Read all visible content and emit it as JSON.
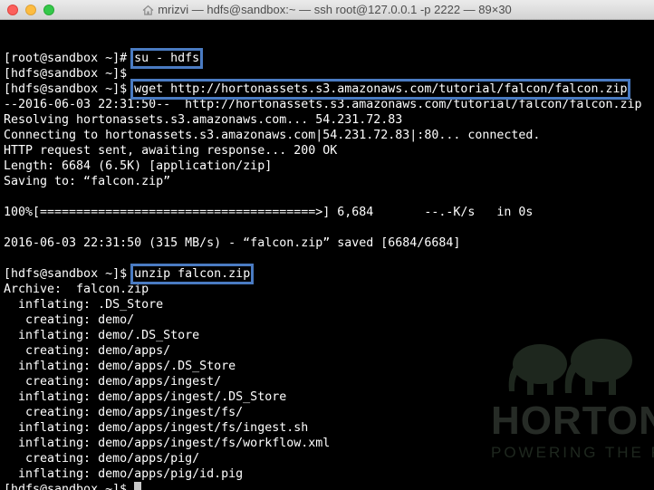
{
  "window": {
    "title": "mrizvi — hdfs@sandbox:~ — ssh root@127.0.0.1 -p 2222 — 89×30"
  },
  "icons": {
    "title_icon": "home-icon",
    "watermark": "hortonworks-elephant-logo"
  },
  "colors": {
    "background": "#000000",
    "text": "#ffffff",
    "highlight": "#4a7bc2"
  },
  "watermark": {
    "word": "HORTON",
    "tagline": "POWERING THE F"
  },
  "terminal": {
    "lines": [
      {
        "prompt": "",
        "command": ""
      },
      {
        "prompt": "[root@sandbox ~]# ",
        "command": "su - hdfs"
      },
      {
        "prompt": "[hdfs@sandbox ~]$",
        "command": ""
      },
      {
        "prompt": "[hdfs@sandbox ~]$ ",
        "command": "wget http://hortonassets.s3.amazonaws.com/tutorial/falcon/falcon.zip"
      },
      {
        "text": "--2016-06-03 22:31:50--  http://hortonassets.s3.amazonaws.com/tutorial/falcon/falcon.zip"
      },
      {
        "text": "Resolving hortonassets.s3.amazonaws.com... 54.231.72.83"
      },
      {
        "text": "Connecting to hortonassets.s3.amazonaws.com|54.231.72.83|:80... connected."
      },
      {
        "text": "HTTP request sent, awaiting response... 200 OK"
      },
      {
        "text": "Length: 6684 (6.5K) [application/zip]"
      },
      {
        "text": "Saving to: “falcon.zip”"
      },
      {
        "text": ""
      },
      {
        "text": "100%[======================================>] 6,684       --.-K/s   in 0s"
      },
      {
        "text": ""
      },
      {
        "text": "2016-06-03 22:31:50 (315 MB/s) - “falcon.zip” saved [6684/6684]"
      },
      {
        "text": ""
      },
      {
        "prompt": "[hdfs@sandbox ~]$ ",
        "command": "unzip falcon.zip"
      },
      {
        "text": "Archive:  falcon.zip"
      },
      {
        "text": "  inflating: .DS_Store"
      },
      {
        "text": "   creating: demo/"
      },
      {
        "text": "  inflating: demo/.DS_Store"
      },
      {
        "text": "   creating: demo/apps/"
      },
      {
        "text": "  inflating: demo/apps/.DS_Store"
      },
      {
        "text": "   creating: demo/apps/ingest/"
      },
      {
        "text": "  inflating: demo/apps/ingest/.DS_Store"
      },
      {
        "text": "   creating: demo/apps/ingest/fs/"
      },
      {
        "text": "  inflating: demo/apps/ingest/fs/ingest.sh"
      },
      {
        "text": "  inflating: demo/apps/ingest/fs/workflow.xml"
      },
      {
        "text": "   creating: demo/apps/pig/"
      },
      {
        "text": "  inflating: demo/apps/pig/id.pig"
      },
      {
        "prompt": "[hdfs@sandbox ~]$ ",
        "command": "",
        "cursor": true
      }
    ]
  }
}
